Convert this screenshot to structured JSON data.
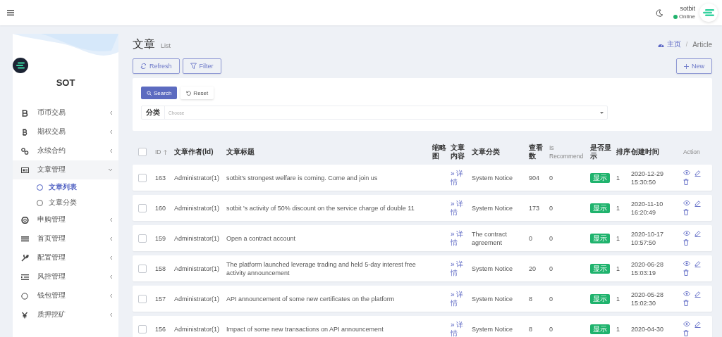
{
  "topbar": {
    "user": "sotbit",
    "status": "Online"
  },
  "sidebar": {
    "brand": "SOT",
    "items": [
      {
        "label": "币币交易",
        "expanded": false
      },
      {
        "label": "期权交易",
        "expanded": false
      },
      {
        "label": "永续合约",
        "expanded": false
      },
      {
        "label": "文章管理",
        "expanded": true,
        "children": [
          {
            "label": "文章列表",
            "selected": true
          },
          {
            "label": "文章分类",
            "selected": false
          }
        ]
      },
      {
        "label": "申购管理",
        "expanded": false
      },
      {
        "label": "首页管理",
        "expanded": false
      },
      {
        "label": "配置管理",
        "expanded": false
      },
      {
        "label": "风控管理",
        "expanded": false
      },
      {
        "label": "钱包管理",
        "expanded": false
      },
      {
        "label": "质押挖矿",
        "expanded": false
      }
    ]
  },
  "page": {
    "title": "文章",
    "subtitle": "List",
    "breadcrumb": [
      "主页",
      "Article"
    ],
    "breadcrumb_separator": "/"
  },
  "toolbar": {
    "buttons": [
      "Refresh",
      "Filter"
    ],
    "new_button": "New"
  },
  "filter": {
    "search_button": "Search",
    "reset_button": "Reset",
    "field_label": "分类",
    "placeholder": "Choose"
  },
  "table": {
    "select_all_checked": false,
    "columns": [
      "ID",
      "文章作者(Id)",
      "文章标题",
      "缩略图",
      "文章内容",
      "文章分类",
      "查看数",
      "Is Recommend",
      "是否显示",
      "排序",
      "创建时间",
      "Action"
    ],
    "rows": [
      {
        "checked": false,
        "id": "163",
        "author": "Administrator(1)",
        "title": "sotbit's strongest welfare is coming. Come and join us",
        "content": "» 详情",
        "category": "System Notice",
        "views": "904",
        "recommend": "0",
        "show": "显示",
        "sort": "1",
        "created": "2020-12-29 15:30:50"
      },
      {
        "checked": false,
        "id": "160",
        "author": "Administrator(1)",
        "title": "sotbit 's activity of 50% discount on the service charge of double 11",
        "content": "» 详情",
        "category": "System Notice",
        "views": "173",
        "recommend": "0",
        "show": "显示",
        "sort": "1",
        "created": "2020-11-10 16:20:49"
      },
      {
        "checked": false,
        "id": "159",
        "author": "Administrator(1)",
        "title": "Open a contract account",
        "content": "» 详情",
        "category": "The contract agreement",
        "views": "0",
        "recommend": "0",
        "show": "显示",
        "sort": "1",
        "created": "2020-10-17 10:57:50"
      },
      {
        "checked": false,
        "id": "158",
        "author": "Administrator(1)",
        "title": "The platform launched leverage trading and held 5-day interest free activity announcement",
        "content": "» 详情",
        "category": "System Notice",
        "views": "20",
        "recommend": "0",
        "show": "显示",
        "sort": "1",
        "created": "2020-06-28 15:03:19"
      },
      {
        "checked": false,
        "id": "157",
        "author": "Administrator(1)",
        "title": "API announcement of some new certificates on the platform",
        "content": "» 详情",
        "category": "System Notice",
        "views": "8",
        "recommend": "0",
        "show": "显示",
        "sort": "1",
        "created": "2020-05-28 15:02:30"
      },
      {
        "checked": false,
        "id": "156",
        "author": "Administrator(1)",
        "title": "Impact of some new transactions on API announcement",
        "content": "» 详情",
        "category": "System Notice",
        "views": "8",
        "recommend": "0",
        "show": "显示",
        "sort": "1",
        "created": "2020-04-30"
      }
    ]
  }
}
